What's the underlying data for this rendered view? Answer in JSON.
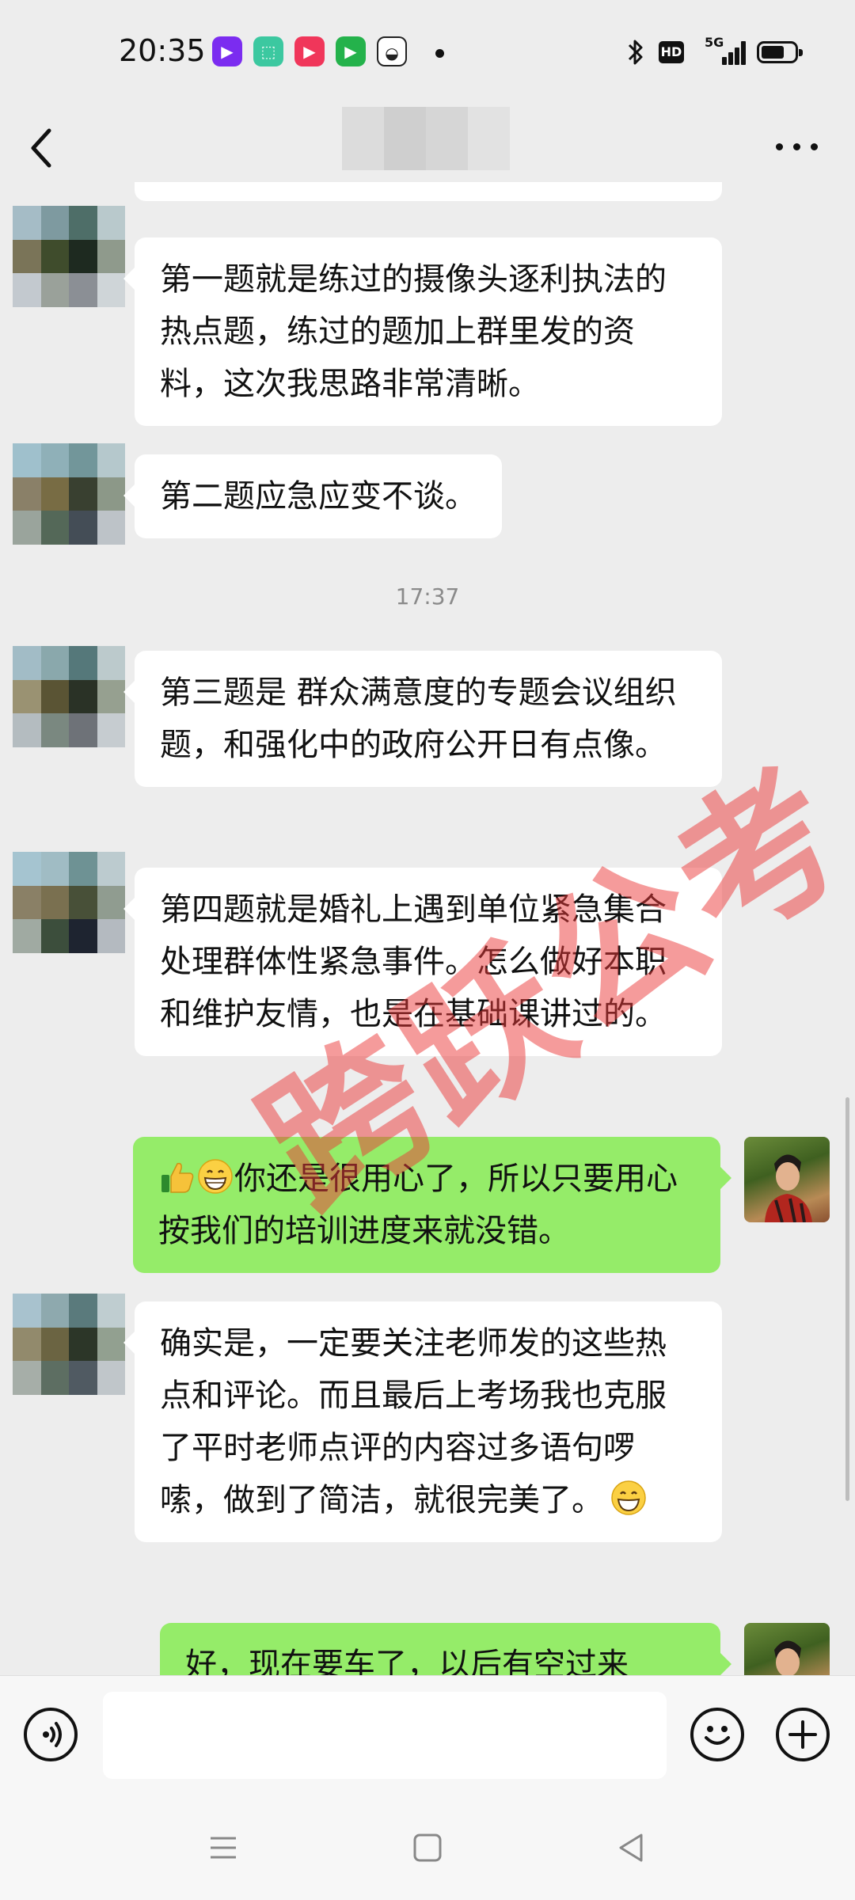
{
  "status_bar": {
    "time": "20:35",
    "hd_label": "HD",
    "network_label": "5G",
    "app_icons": [
      {
        "name": "video-app-icon",
        "color": "#7b2cf0",
        "glyph": "▶"
      },
      {
        "name": "shop-app-icon",
        "color": "#3cc8a0",
        "glyph": "⬚"
      },
      {
        "name": "play-app-icon",
        "color": "#f0365a",
        "glyph": "▶"
      },
      {
        "name": "tencent-video-icon",
        "color": "#24b24b",
        "glyph": "▶"
      },
      {
        "name": "game-app-icon",
        "color": "#222222",
        "glyph": "◒"
      }
    ]
  },
  "chat": {
    "timestamp": "17:37",
    "messages": [
      {
        "side": "left",
        "text": "第一题就是练过的摄像头逐利执法的热点题，练过的题加上群里发的资料，这次我思路非常清晰。"
      },
      {
        "side": "left",
        "text": "第二题应急应变不谈。"
      },
      {
        "side": "left",
        "text": "第三题是 群众满意度的专题会议组织题，和强化中的政府公开日有点像。"
      },
      {
        "side": "left",
        "text": "第四题就是婚礼上遇到单位紧急集合处理群体性紧急事件。怎么做好本职和维护友情，也是在基础课讲过的。"
      },
      {
        "side": "right",
        "text": "你还是很用心了，所以只要用心按我们的培训进度来就没错。",
        "emojis": [
          "thumbs-up",
          "grinning"
        ]
      },
      {
        "side": "left",
        "text": "确实是，一定要关注老师发的这些热点和评论。而且最后上考场我也克服了平时老师点评的内容过多语句啰嗦，做到了简洁，就很完美了。",
        "emojis": [
          "grinning"
        ]
      },
      {
        "side": "right",
        "text": "好，现在要车了，以后有空过来"
      }
    ]
  },
  "watermark": "跨跃公考",
  "colors": {
    "my_bubble": "#95ec69",
    "their_bubble": "#ffffff",
    "background": "#ededed",
    "watermark": "#eb3737"
  }
}
